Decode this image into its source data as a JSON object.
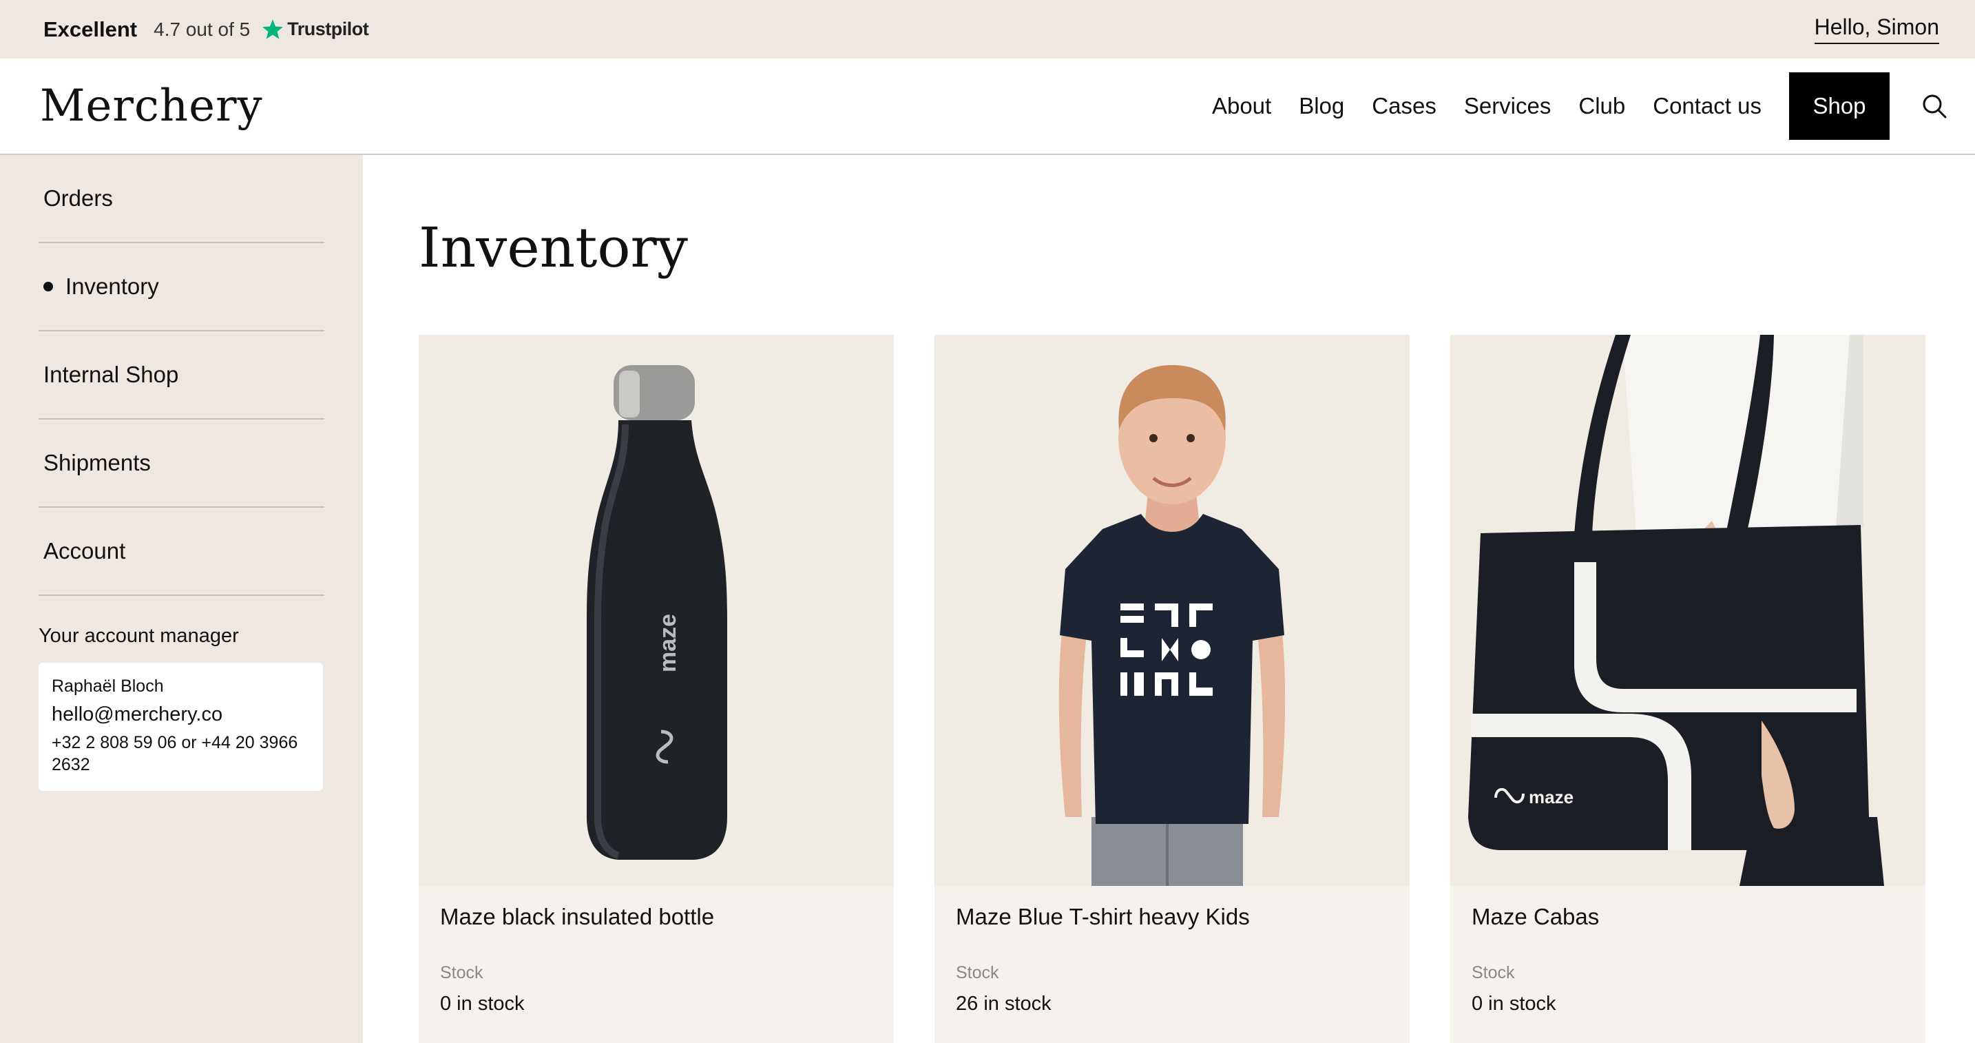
{
  "topbar": {
    "rating_word": "Excellent",
    "rating_text": "4.7 out of 5",
    "trust_icon": "star-icon",
    "trust_brand": "Trustpilot",
    "greeting": "Hello, Simon"
  },
  "header": {
    "logo": "Merchery",
    "nav": {
      "about": "About",
      "blog": "Blog",
      "cases": "Cases",
      "services": "Services",
      "club": "Club",
      "contact": "Contact us",
      "shop": "Shop"
    },
    "search_icon": "search-icon"
  },
  "sidebar": {
    "items": [
      {
        "label": "Orders",
        "active": false
      },
      {
        "label": "Inventory",
        "active": true
      },
      {
        "label": "Internal Shop",
        "active": false
      },
      {
        "label": "Shipments",
        "active": false
      },
      {
        "label": "Account",
        "active": false
      }
    ],
    "manager": {
      "title": "Your account manager",
      "name": "Raphaël Bloch",
      "email": "hello@merchery.co",
      "phone": "+32 2 808 59 06 or +44 20 3966 2632"
    }
  },
  "main": {
    "title": "Inventory",
    "products": [
      {
        "name": "Maze black insulated bottle",
        "stock_label": "Stock",
        "stock": "0 in stock",
        "brand_mark": "maze"
      },
      {
        "name": "Maze Blue T-shirt heavy Kids",
        "stock_label": "Stock",
        "stock": "26 in stock"
      },
      {
        "name": "Maze Cabas",
        "stock_label": "Stock",
        "stock": "0 in stock",
        "brand_mark": "maze"
      }
    ]
  },
  "colors": {
    "beige": "#efe8e2",
    "card": "#f5f1ec",
    "accent": "#000000",
    "trust_green": "#00b67a"
  }
}
